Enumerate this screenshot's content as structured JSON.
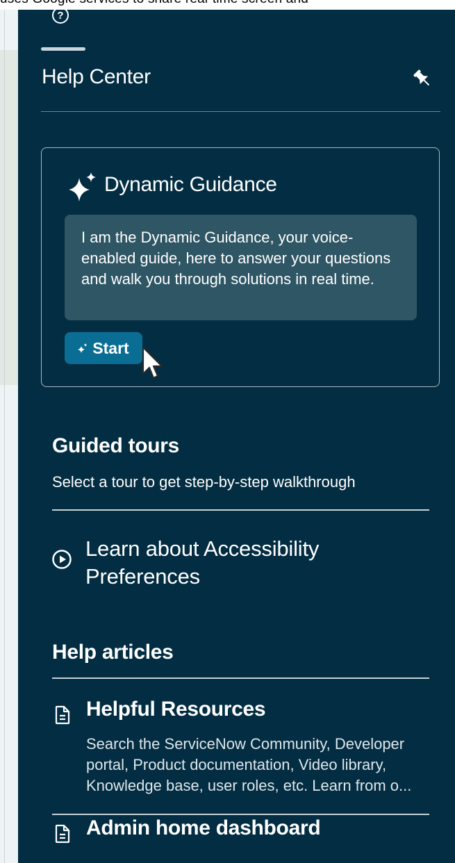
{
  "top_strip_text": "uses Google services to share real-time screen and",
  "panel": {
    "help_icon": "question-circle-icon",
    "title": "Help Center",
    "pin_icon": "pin-icon"
  },
  "dynamic_guidance": {
    "icon": "sparkle-icon",
    "title": "Dynamic Guidance",
    "message": "I am the Dynamic Guidance, your voice-enabled guide, here to answer your questions and walk you through solutions in real time.",
    "start_label": "Start"
  },
  "guided_tours": {
    "heading": "Guided tours",
    "subtitle": "Select a tour to get step-by-step walkthrough",
    "items": [
      {
        "icon": "play-circle-icon",
        "label": "Learn about Accessibility Preferences"
      }
    ]
  },
  "help_articles": {
    "heading": "Help articles",
    "items": [
      {
        "icon": "document-icon",
        "title": "Helpful Resources",
        "description": "Search the ServiceNow Community, Developer portal, Product documentation, Video library, Knowledge base, user roles, etc. Learn from o..."
      },
      {
        "icon": "document-icon",
        "title": "Admin home dashboard",
        "description": ""
      }
    ]
  },
  "colors": {
    "panel_bg": "#032d42",
    "bubble_bg": "#2f5665",
    "start_button": "#0a6d94"
  }
}
